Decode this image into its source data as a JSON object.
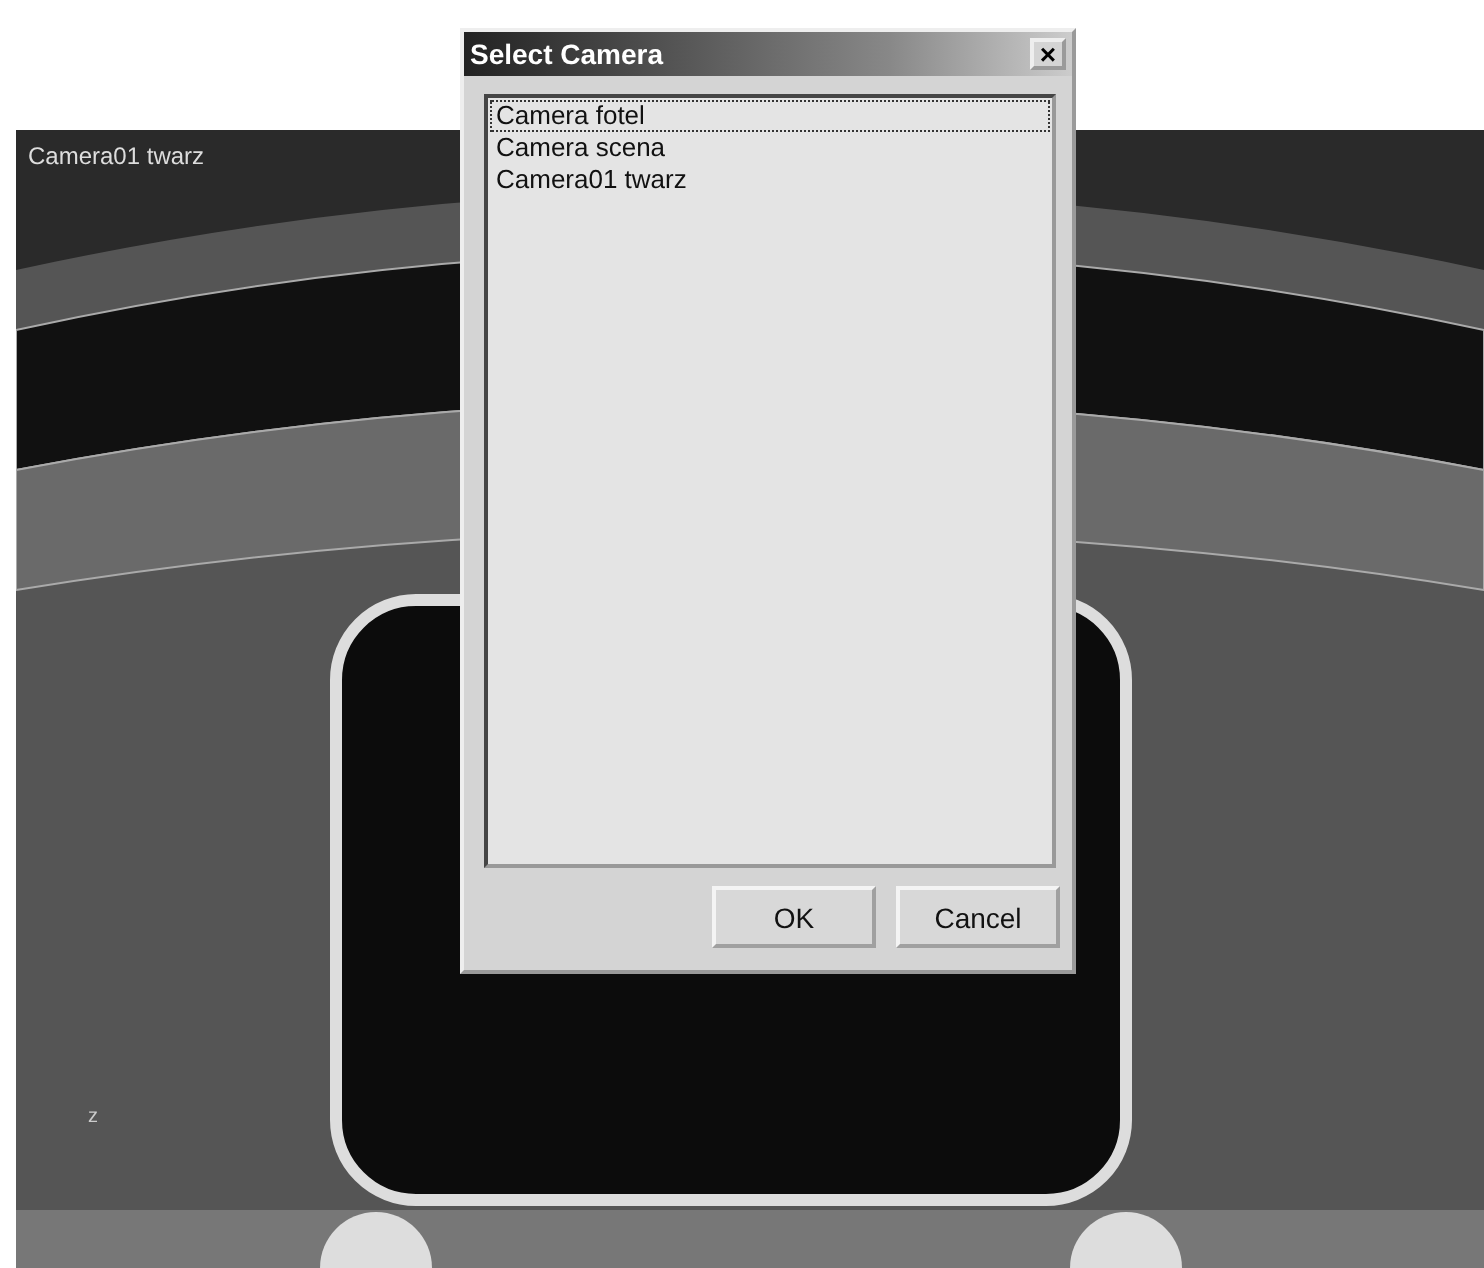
{
  "viewport": {
    "label": "Camera01 twarz",
    "axis_label": "z"
  },
  "dialog": {
    "title": "Select Camera",
    "close": "×",
    "cameras": [
      {
        "name": "Camera fotel",
        "selected": true
      },
      {
        "name": "Camera scena",
        "selected": false
      },
      {
        "name": "Camera01 twarz",
        "selected": false
      }
    ],
    "buttons": [
      "OK",
      "Cancel"
    ]
  }
}
